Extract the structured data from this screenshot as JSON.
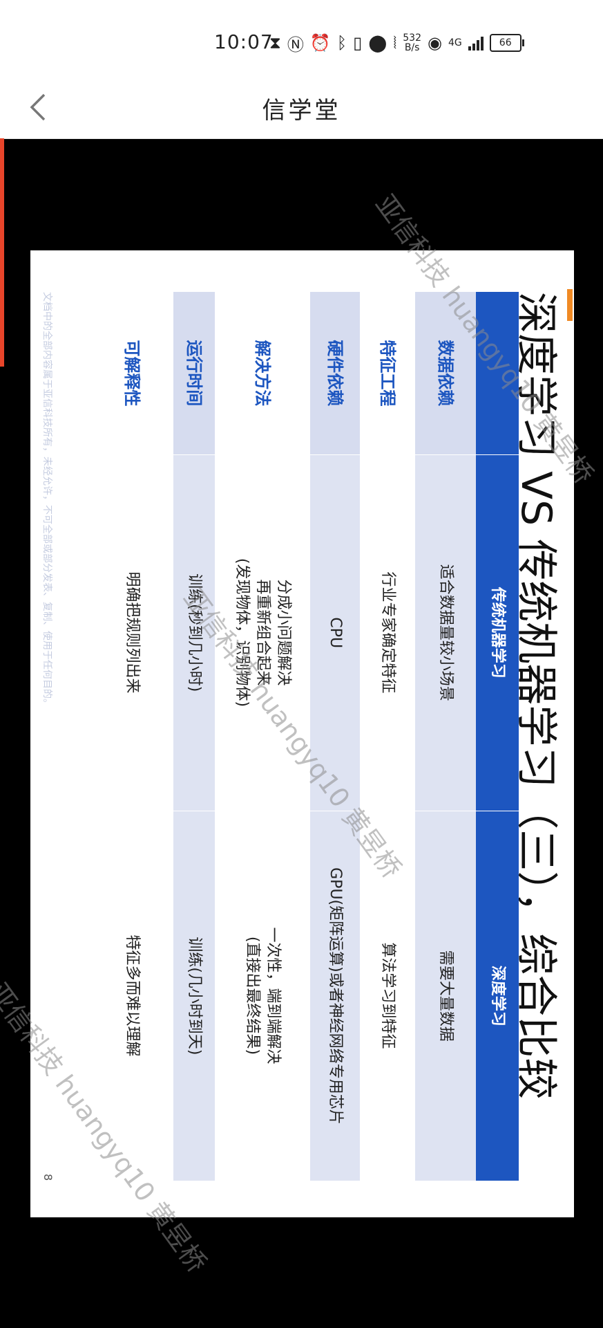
{
  "status_bar": {
    "time": "10:07",
    "net_speed_value": "532",
    "net_speed_unit": "B/s",
    "network": "4G",
    "battery": "66",
    "icons": [
      "hourglass-icon",
      "nfc-icon",
      "alarm-icon",
      "bluetooth-icon",
      "vibrate-icon",
      "location-icon",
      "vibration-icon",
      "hotspot-icon",
      "signal-icon",
      "battery-icon"
    ]
  },
  "app_bar": {
    "title": "信学堂",
    "back_icon": "chevron-left-icon"
  },
  "slide": {
    "title": "深度学习 VS 传统机器学习（三），综合比较",
    "table": {
      "headers": [
        "",
        "传统机器学习",
        "深度学习"
      ],
      "rows": [
        {
          "label": "数据依赖",
          "ml": "适合数据量较小场景",
          "dl": "需要大量数据"
        },
        {
          "label": "特征工程",
          "ml": "行业专家确定特征",
          "dl": "算法学习到特征"
        },
        {
          "label": "硬件依赖",
          "ml": "CPU",
          "dl": "GPU(矩阵运算)或者神经网络专用芯片"
        },
        {
          "label": "解决方法",
          "ml": "分成小问题解决\n再重新组合起来\n(发现物体，识别物体)",
          "dl": "一次性，端到端解决\n(直接出最终结果)"
        },
        {
          "label": "运行时间",
          "ml": "训练(秒到几小时)",
          "dl": "训练(几小时到天)"
        },
        {
          "label": "可解释性",
          "ml": "明确把规则列出来",
          "dl": "特征多而难以理解"
        }
      ]
    },
    "footnote": "文档中的全部内容属于亚信科技所有，未经允许，不可全部或部分发表、复制、使用于任何目的。",
    "page_number": "8"
  },
  "watermark": {
    "text": "亚信科技 huangyq10 黄昱桥"
  },
  "colors": {
    "header_blue": "#1d56c0",
    "row_shade": "#dee3f2",
    "accent": "#e8452a",
    "title_mark": "#f08a24"
  }
}
